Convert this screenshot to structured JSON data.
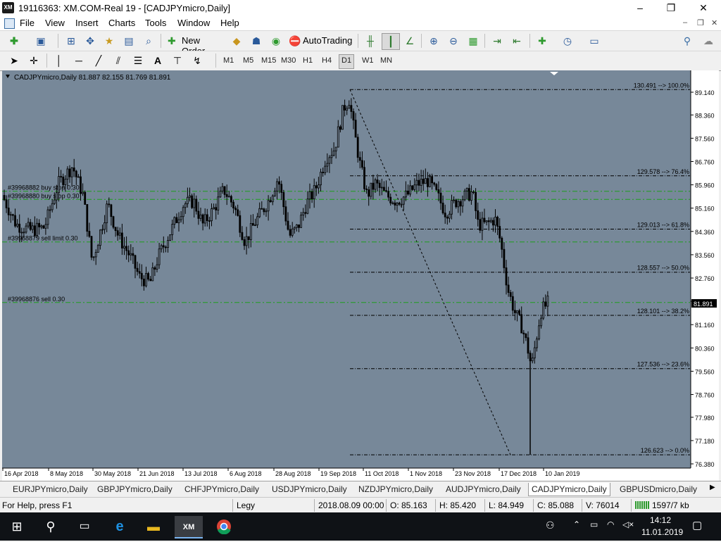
{
  "window": {
    "title": "19116363: XM.COM-Real 19 - [CADJPYmicro,Daily]",
    "app_icon_text": "XM",
    "minimize": "–",
    "maximize": "❐",
    "close": "✕"
  },
  "menu": [
    "File",
    "View",
    "Insert",
    "Charts",
    "Tools",
    "Window",
    "Help"
  ],
  "mdi_controls": [
    "–",
    "❐",
    "✕"
  ],
  "toolbar": {
    "new_order": "New Order",
    "autotrading": "AutoTrading"
  },
  "timeframes": [
    "M1",
    "M5",
    "M15",
    "M30",
    "H1",
    "H4",
    "D1",
    "W1",
    "MN"
  ],
  "active_timeframe": "D1",
  "chart": {
    "header": "CADJPYmicro,Daily  81.887 82.155 81.769 81.891",
    "background": "#778899",
    "candle_color": "#000000",
    "current_price": "81.891",
    "price_axis": [
      "89.140",
      "88.360",
      "87.560",
      "86.760",
      "85.960",
      "85.160",
      "84.360",
      "83.560",
      "82.760",
      "81.960",
      "81.160",
      "80.360",
      "79.560",
      "78.760",
      "77.980",
      "77.180",
      "76.380"
    ],
    "date_axis": [
      "16 Apr 2018",
      "8 May 2018",
      "30 May 2018",
      "21 Jun 2018",
      "13 Jul 2018",
      "6 Aug 2018",
      "28 Aug 2018",
      "19 Sep 2018",
      "11 Oct 2018",
      "1 Nov 2018",
      "23 Nov 2018",
      "17 Dec 2018",
      "10 Jan 2019"
    ],
    "orders": [
      {
        "label": "#39968882 buy stop 0.30",
        "price": 85.74
      },
      {
        "label": "#39968880 buy stop 0.30",
        "price": 85.46
      },
      {
        "label": "#39968879 sell limit 0.30",
        "price": 84.0
      },
      {
        "label": "#39968876 sell 0.30",
        "price": 81.92
      }
    ],
    "fib_levels": [
      {
        "label": "130.491 --> 100.0%",
        "price": 89.23
      },
      {
        "label": "129.578 --> 76.4%",
        "price": 86.27
      },
      {
        "label": "129.013 --> 61.8%",
        "price": 84.44
      },
      {
        "label": "128.557 --> 50.0%",
        "price": 82.96
      },
      {
        "label": "128.101 --> 38.2%",
        "price": 81.48
      },
      {
        "label": "127.536 --> 23.6%",
        "price": 79.65
      },
      {
        "label": "126.623 --> 0.0%",
        "price": 76.69
      }
    ]
  },
  "tabs": [
    "EURJPYmicro,Daily",
    "GBPJPYmicro,Daily",
    "CHFJPYmicro,Daily",
    "USDJPYmicro,Daily",
    "NZDJPYmicro,Daily",
    "AUDJPYmicro,Daily",
    "CADJPYmicro,Daily",
    "GBPUSDmicro,Daily"
  ],
  "active_tab": "CADJPYmicro,Daily",
  "status": {
    "help": "For Help, press F1",
    "profile": "Legy",
    "datetime": "2018.08.09 00:00",
    "open": "O: 85.163",
    "high": "H: 85.420",
    "low": "L: 84.949",
    "close": "C: 85.088",
    "volume": "V: 76014",
    "traffic": "1597/7 kb"
  },
  "taskbar": {
    "time": "14:12",
    "date": "11.01.2019"
  }
}
